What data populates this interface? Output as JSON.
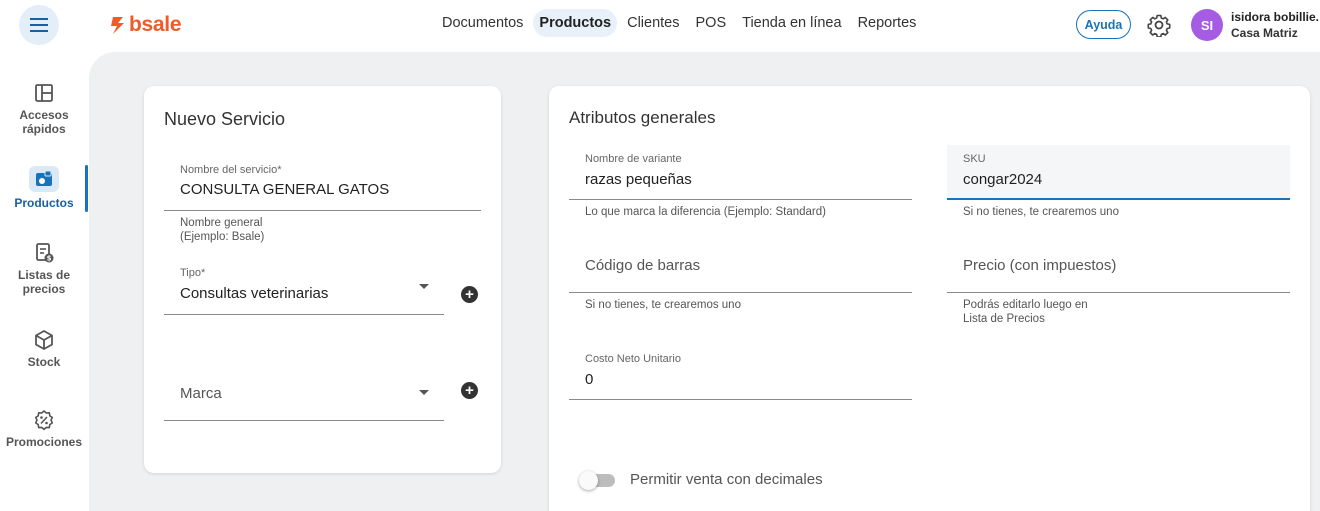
{
  "header": {
    "logo": "bsale",
    "nav": [
      "Documentos",
      "Productos",
      "Clientes",
      "POS",
      "Tienda en línea",
      "Reportes"
    ],
    "active_nav": "Productos",
    "help_label": "Ayuda",
    "avatar_initials": "SI",
    "user_name": "isidora bobillie.",
    "user_branch": "Casa Matriz"
  },
  "sidebar": {
    "items": [
      {
        "label_line1": "Accesos",
        "label_line2": "rápidos",
        "icon": "grid-layout-icon"
      },
      {
        "label_line1": "Productos",
        "label_line2": "",
        "icon": "products-tag-icon"
      },
      {
        "label_line1": "Listas de",
        "label_line2": "precios",
        "icon": "price-list-icon"
      },
      {
        "label_line1": "Stock",
        "label_line2": "",
        "icon": "cube-icon"
      },
      {
        "label_line1": "Promociones",
        "label_line2": "",
        "icon": "discount-badge-icon"
      }
    ],
    "active": "Productos"
  },
  "service_card": {
    "title": "Nuevo Servicio",
    "name_label": "Nombre del servicio*",
    "name_value": "CONSULTA GENERAL GATOS",
    "name_hint_line1": "Nombre general",
    "name_hint_line2": "(Ejemplo: Bsale)",
    "type_label": "Tipo*",
    "type_value": "Consultas veterinarias",
    "brand_placeholder": "Marca"
  },
  "attributes_card": {
    "title": "Atributos generales",
    "variant_label": "Nombre de variante",
    "variant_value": "razas pequeñas",
    "variant_hint": "Lo que marca la diferencia (Ejemplo: Standard)",
    "sku_label": "SKU",
    "sku_value": "congar2024",
    "sku_hint": "Si no tienes, te crearemos uno",
    "barcode_placeholder": "Código de barras",
    "barcode_hint": "Si no tienes, te crearemos uno",
    "price_placeholder": "Precio (con impuestos)",
    "price_hint_line1": "Podrás editarlo luego en",
    "price_hint_line2": "Lista de Precios",
    "cost_label": "Costo Neto Unitario",
    "cost_value": "0",
    "decimals_label": "Permitir venta con decimales",
    "decimals_enabled": false
  },
  "colors": {
    "brand": "#f05a28",
    "accent": "#1a73b8",
    "avatar": "#a55ce3"
  }
}
